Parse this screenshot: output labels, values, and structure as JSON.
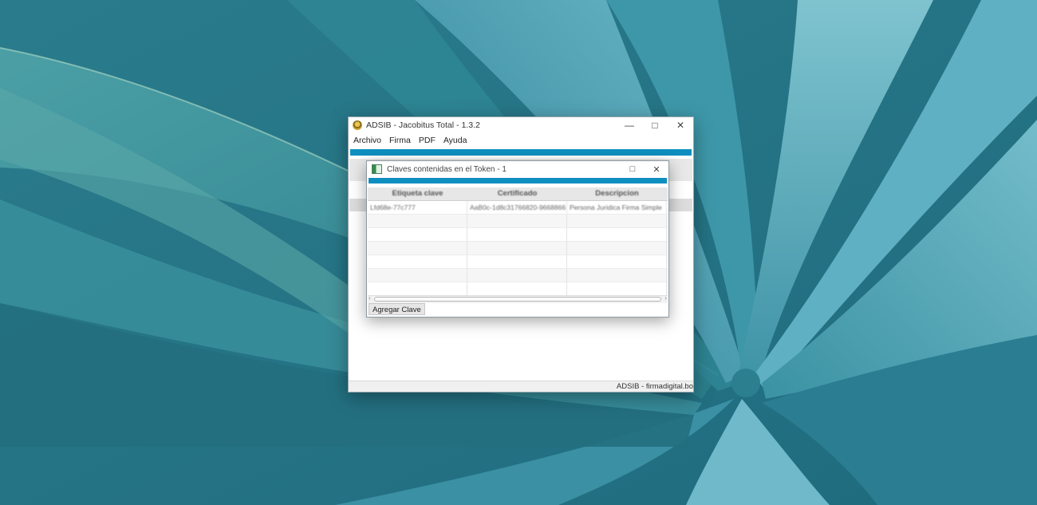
{
  "main_window": {
    "title": "ADSIB - Jacobitus Total - 1.3.2",
    "menu": [
      "Archivo",
      "Firma",
      "PDF",
      "Ayuda"
    ],
    "status": "ADSIB - firmadigital.bo"
  },
  "dialog": {
    "title": "Claves contenidas en el Token - 1",
    "columns": [
      "Etiqueta clave",
      "Certificado",
      "Descripcion"
    ],
    "rows": [
      [
        "Lfd68e-77c777",
        "AaB0c-1d8c31766820-9668866",
        "Persona Juridica Firma Simple"
      ]
    ],
    "add_button": "Agregar Clave"
  },
  "icons": {
    "minimize": "minimize-icon",
    "maximize": "maximize-icon",
    "close": "close-icon"
  },
  "colors": {
    "accent": "#0e8fc0"
  }
}
